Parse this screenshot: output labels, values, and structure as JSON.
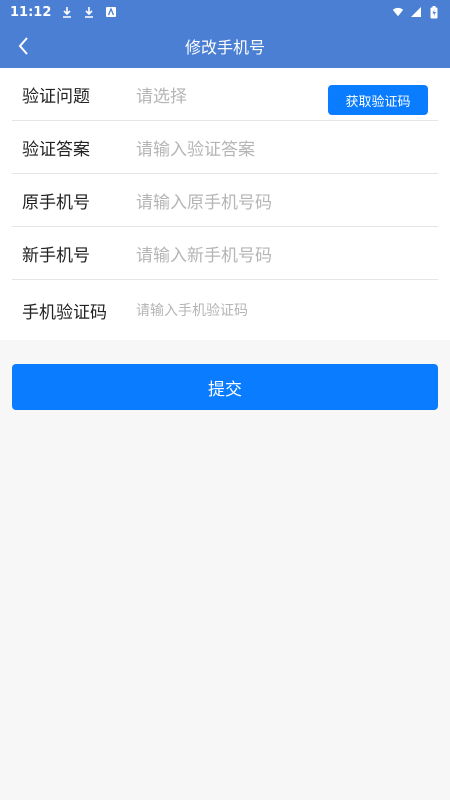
{
  "status_bar": {
    "time": "11:12",
    "icons_left": [
      "download-icon",
      "download-icon",
      "app-notification-icon"
    ],
    "icons_right": [
      "wifi-icon",
      "signal-icon",
      "battery-charging-icon"
    ]
  },
  "header": {
    "title": "修改手机号",
    "back_icon": "chevron-left-icon",
    "bg_color": "#4a7fd3"
  },
  "form": {
    "rows": [
      {
        "label": "验证问题",
        "placeholder": "请选择",
        "type": "select"
      },
      {
        "label": "验证答案",
        "placeholder": "请输入验证答案",
        "type": "input"
      },
      {
        "label": "原手机号",
        "placeholder": "请输入原手机号码",
        "type": "input"
      },
      {
        "label": "新手机号",
        "placeholder": "请输入新手机号码",
        "type": "input"
      },
      {
        "label": "手机验证码",
        "placeholder": "请输入手机验证码",
        "type": "input"
      }
    ],
    "get_code_button": "获取验证码"
  },
  "submit_button": "提交",
  "accent_color": "#0a7cff"
}
